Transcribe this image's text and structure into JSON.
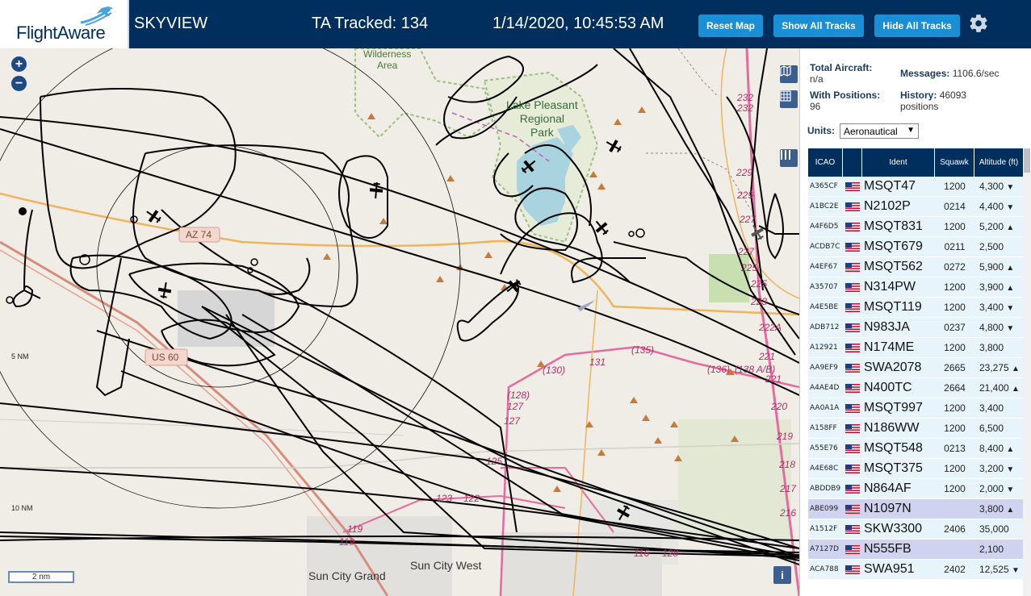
{
  "header": {
    "logo_text": "FlightAware",
    "app_title": "SKYVIEW",
    "ta_tracked": "TA Tracked: 134",
    "datetime": "1/14/2020, 10:45:53 AM",
    "buttons": {
      "reset_map": "Reset Map",
      "show_all_tracks": "Show All Tracks",
      "hide_all_tracks": "Hide All Tracks"
    }
  },
  "map": {
    "labels": {
      "wilderness": "Wilderness\nArea",
      "lake": "Lake Pleasant\nRegional\nPark",
      "az74": "AZ 74",
      "us60": "US 60",
      "sun_city_grand": "Sun City Grand",
      "sun_city_west": "Sun City West",
      "ring_5nm": "5 NM",
      "ring_10nm": "10 NM",
      "scale": "2 nm"
    },
    "road_numbers": [
      "232",
      "229",
      "227",
      "225",
      "223",
      "222A",
      "221",
      "220",
      "219",
      "218",
      "217",
      "216",
      "(135)",
      "(136)",
      "(138 A/B)",
      "(130)",
      "131",
      "(128)",
      "127",
      "125",
      "123",
      "122",
      "119",
      "116"
    ]
  },
  "sidebar": {
    "stats": {
      "total_aircraft_label": "Total Aircraft:",
      "total_aircraft_value": "n/a",
      "with_positions_label": "With Positions:",
      "with_positions_value": "96",
      "messages_label": "Messages:",
      "messages_value": "1106.6/sec",
      "history_label": "History:",
      "history_value": "46093 positions"
    },
    "units_label": "Units:",
    "units_value": "Aeronautical",
    "table": {
      "headers": {
        "icao": "ICAO",
        "ident": "Ident",
        "squawk": "Squawk",
        "altitude": "Altitude (ft)"
      },
      "rows": [
        {
          "icao": "A365CF",
          "ident": "MSQT47",
          "squawk": "1200",
          "altitude": "4,300",
          "trend": "▼"
        },
        {
          "icao": "A1BC2E",
          "ident": "N2102P",
          "squawk": "0214",
          "altitude": "4,400",
          "trend": "▼"
        },
        {
          "icao": "A4F6D5",
          "ident": "MSQT831",
          "squawk": "1200",
          "altitude": "5,200",
          "trend": "▲"
        },
        {
          "icao": "ACDB7C",
          "ident": "MSQT679",
          "squawk": "0211",
          "altitude": "2,500",
          "trend": ""
        },
        {
          "icao": "A4EF67",
          "ident": "MSQT562",
          "squawk": "0272",
          "altitude": "5,900",
          "trend": "▲"
        },
        {
          "icao": "A35707",
          "ident": "N314PW",
          "squawk": "1200",
          "altitude": "3,900",
          "trend": "▲"
        },
        {
          "icao": "A4E5BE",
          "ident": "MSQT119",
          "squawk": "1200",
          "altitude": "3,400",
          "trend": "▼"
        },
        {
          "icao": "ADB712",
          "ident": "N983JA",
          "squawk": "0237",
          "altitude": "4,800",
          "trend": "▼"
        },
        {
          "icao": "A12921",
          "ident": "N174ME",
          "squawk": "1200",
          "altitude": "3,800",
          "trend": ""
        },
        {
          "icao": "AA9EF9",
          "ident": "SWA2078",
          "squawk": "2665",
          "altitude": "23,275",
          "trend": "▲"
        },
        {
          "icao": "A4AE4D",
          "ident": "N400TC",
          "squawk": "2664",
          "altitude": "21,400",
          "trend": "▲"
        },
        {
          "icao": "AA0A1A",
          "ident": "MSQT997",
          "squawk": "1200",
          "altitude": "3,400",
          "trend": ""
        },
        {
          "icao": "A158FF",
          "ident": "N186WW",
          "squawk": "1200",
          "altitude": "6,500",
          "trend": ""
        },
        {
          "icao": "A55E76",
          "ident": "MSQT548",
          "squawk": "0213",
          "altitude": "8,400",
          "trend": "▲"
        },
        {
          "icao": "A4E68C",
          "ident": "MSQT375",
          "squawk": "1200",
          "altitude": "3,200",
          "trend": "▼"
        },
        {
          "icao": "ABDDB9",
          "ident": "N864AF",
          "squawk": "1200",
          "altitude": "2,000",
          "trend": "▼"
        },
        {
          "icao": "ABE099",
          "ident": "N1097N",
          "squawk": "",
          "altitude": "3,800",
          "trend": "▲",
          "selected": true
        },
        {
          "icao": "A1512F",
          "ident": "SKW3300",
          "squawk": "2406",
          "altitude": "35,000",
          "trend": ""
        },
        {
          "icao": "A7127D",
          "ident": "N555FB",
          "squawk": "",
          "altitude": "2,100",
          "trend": "",
          "selected": true
        },
        {
          "icao": "ACA788",
          "ident": "SWA951",
          "squawk": "2402",
          "altitude": "12,525",
          "trend": "▼"
        }
      ]
    }
  },
  "colors": {
    "header_bg": "#002f5d",
    "button_blue": "#1a8fd6",
    "table_header": "#002f5d",
    "row_bg": "#e8f4fb",
    "row_selected": "#cfd3f0",
    "road_pink": "#e66aa0",
    "road_orange": "#f0b35a",
    "lake_blue": "#a9d3df",
    "park_green": "#c8dfb0"
  }
}
